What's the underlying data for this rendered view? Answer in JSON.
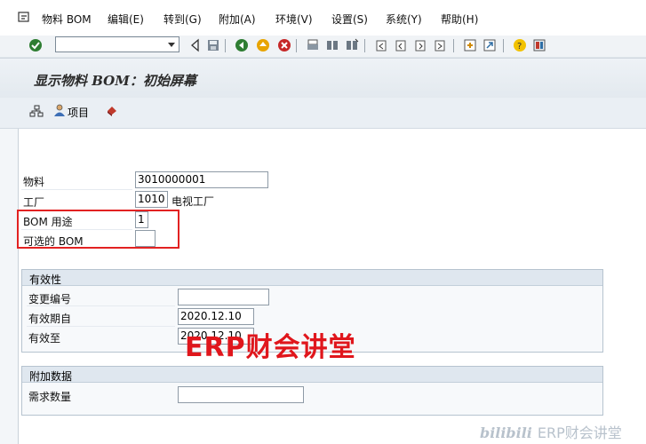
{
  "menu": {
    "items": [
      {
        "label": "物料 BOM"
      },
      {
        "label": "编辑(E)"
      },
      {
        "label": "转到(G)"
      },
      {
        "label": "附加(A)"
      },
      {
        "label": "环境(V)"
      },
      {
        "label": "设置(S)"
      },
      {
        "label": "系统(Y)"
      },
      {
        "label": "帮助(H)"
      }
    ]
  },
  "toolbar": {
    "command_field": "",
    "icons": [
      "enter-icon",
      "back-nav-icon",
      "save-icon",
      "back-icon",
      "exit-icon",
      "cancel-icon",
      "print-icon",
      "find-icon",
      "find-next-icon",
      "first-page-icon",
      "prev-page-icon",
      "next-page-icon",
      "last-page-icon",
      "create-session-icon",
      "shortcut-icon",
      "help-icon",
      "layout-icon"
    ]
  },
  "title": "显示物料 BOM：初始屏幕",
  "app_toolbar": {
    "hierarchy_icon": "hierarchy-icon",
    "item_label": "项目",
    "extra_icon": "eraser-icon"
  },
  "form": {
    "material": {
      "label": "物料",
      "value": "3010000001"
    },
    "plant": {
      "label": "工厂",
      "value": "1010",
      "desc": "电视工厂"
    },
    "bom_usage": {
      "label": "BOM 用途",
      "value": "1"
    },
    "alt_bom": {
      "label": "可选的 BOM",
      "value": ""
    }
  },
  "validity": {
    "title": "有效性",
    "change_number": {
      "label": "变更编号",
      "value": ""
    },
    "valid_from": {
      "label": "有效期自",
      "value": "2020.12.10"
    },
    "valid_to": {
      "label": "有效至",
      "value": "2020.12.10"
    }
  },
  "additional": {
    "title": "附加数据",
    "required_qty": {
      "label": "需求数量",
      "value": ""
    }
  },
  "overlay": {
    "watermark": "ERP财会讲堂",
    "brand_logo": "bilibili",
    "brand_text": "ERP财会讲堂"
  },
  "colors": {
    "highlight": "#e22222",
    "watermark": "#e0161c"
  }
}
